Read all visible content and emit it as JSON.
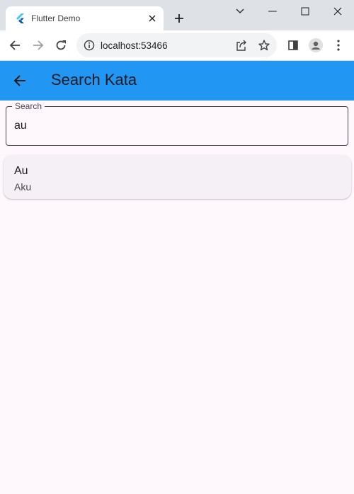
{
  "browser": {
    "tab": {
      "title": "Flutter Demo",
      "favicon": "flutter-icon",
      "close_icon": "close-icon"
    },
    "new_tab_icon": "plus-icon",
    "window_controls": [
      "chevron-down-icon",
      "minimize-icon",
      "maximize-icon",
      "close-icon"
    ],
    "toolbar": {
      "back_icon": "arrow-left-icon",
      "forward_icon": "arrow-right-icon",
      "reload_icon": "reload-icon",
      "url": "localhost:53466",
      "site_info_icon": "info-icon",
      "share_icon": "share-icon",
      "bookmark_icon": "star-icon",
      "side_panel_icon": "side-panel-icon",
      "profile_icon": "avatar-icon",
      "menu_icon": "more-vert-icon"
    }
  },
  "app": {
    "appbar": {
      "title": "Search Kata",
      "back_icon": "arrow-left-icon",
      "color": "#2196f3"
    },
    "search": {
      "label": "Search",
      "value": "au"
    },
    "results": [
      {
        "title": "Au",
        "subtitle": "Aku"
      }
    ]
  }
}
